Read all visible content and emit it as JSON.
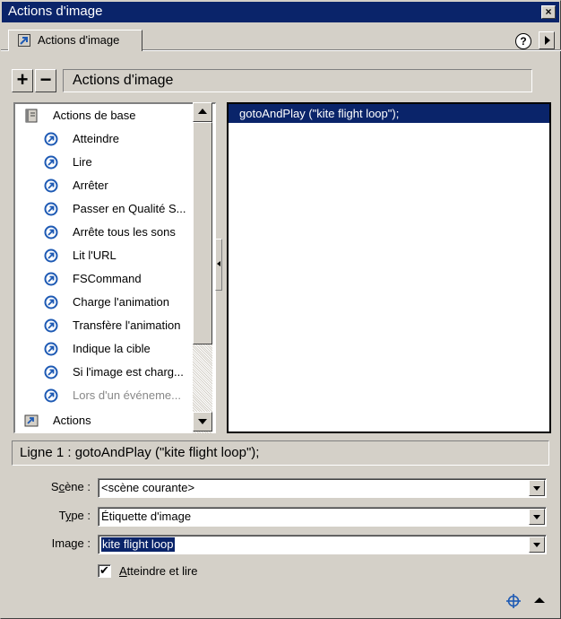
{
  "window": {
    "title": "Actions d'image"
  },
  "tab": {
    "label": "Actions d'image",
    "icon": "action-arrow-icon"
  },
  "help": {
    "label": "?"
  },
  "toolbar": {
    "add_label": "+",
    "remove_label": "−",
    "panel_title": "Actions d'image"
  },
  "tree": {
    "header": "Actions de base",
    "items": [
      {
        "label": "Atteindre"
      },
      {
        "label": "Lire"
      },
      {
        "label": "Arrêter"
      },
      {
        "label": "Passer en Qualité S..."
      },
      {
        "label": "Arrête tous les sons"
      },
      {
        "label": "Lit l'URL"
      },
      {
        "label": "FSCommand"
      },
      {
        "label": "Charge l'animation"
      },
      {
        "label": "Transfère l'animation"
      },
      {
        "label": "Indique la cible"
      },
      {
        "label": "Si l'image est charg..."
      },
      {
        "label": "Lors d'un événeme..."
      }
    ],
    "footer": "Actions"
  },
  "script": {
    "lines": [
      "gotoAndPlay (\"kite flight loop\");"
    ]
  },
  "status": {
    "text": "Ligne 1 : gotoAndPlay (\"kite flight loop\");"
  },
  "form": {
    "scene": {
      "label_pre": "S",
      "label_u": "c",
      "label_post": "ène :",
      "value": "<scène courante>"
    },
    "type": {
      "label_pre": "T",
      "label_u": "y",
      "label_post": "pe :",
      "value": "Étiquette d'image"
    },
    "image": {
      "label": "Image :",
      "value": "kite flight loop"
    },
    "goto_play": {
      "checked": true,
      "check_mark": "✔",
      "label_u": "A",
      "label_rest": "tteindre et lire"
    }
  },
  "colors": {
    "titlebar": "#0a246a",
    "selection": "#0a246a",
    "face": "#d4d0c8",
    "icon_blue": "#1e5ab4"
  }
}
